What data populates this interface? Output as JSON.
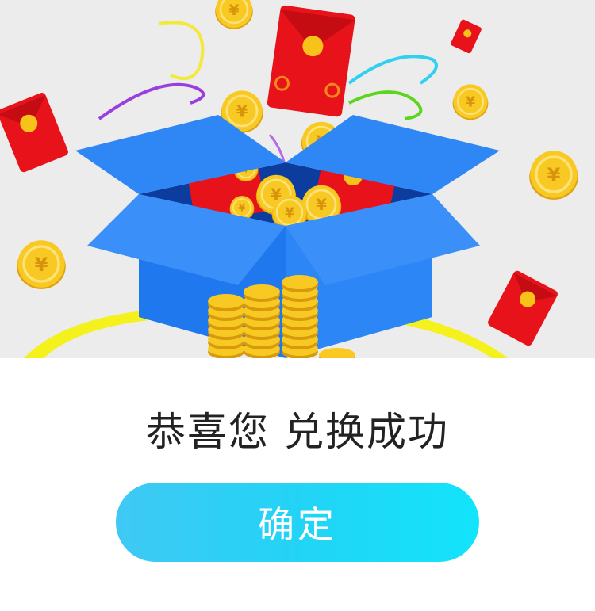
{
  "dialog": {
    "success_message": "恭喜您 兑换成功",
    "confirm_label": "确定"
  },
  "illustration": {
    "currency_symbol": "¥",
    "colors": {
      "background": "#ececec",
      "box_blue": "#2f86f5",
      "box_dark": "#0c3d9e",
      "red_envelope": "#e8121a",
      "coin_gold": "#f7c21a",
      "button_gradient_start": "#3fc9f4",
      "button_gradient_end": "#12e4fb"
    }
  }
}
